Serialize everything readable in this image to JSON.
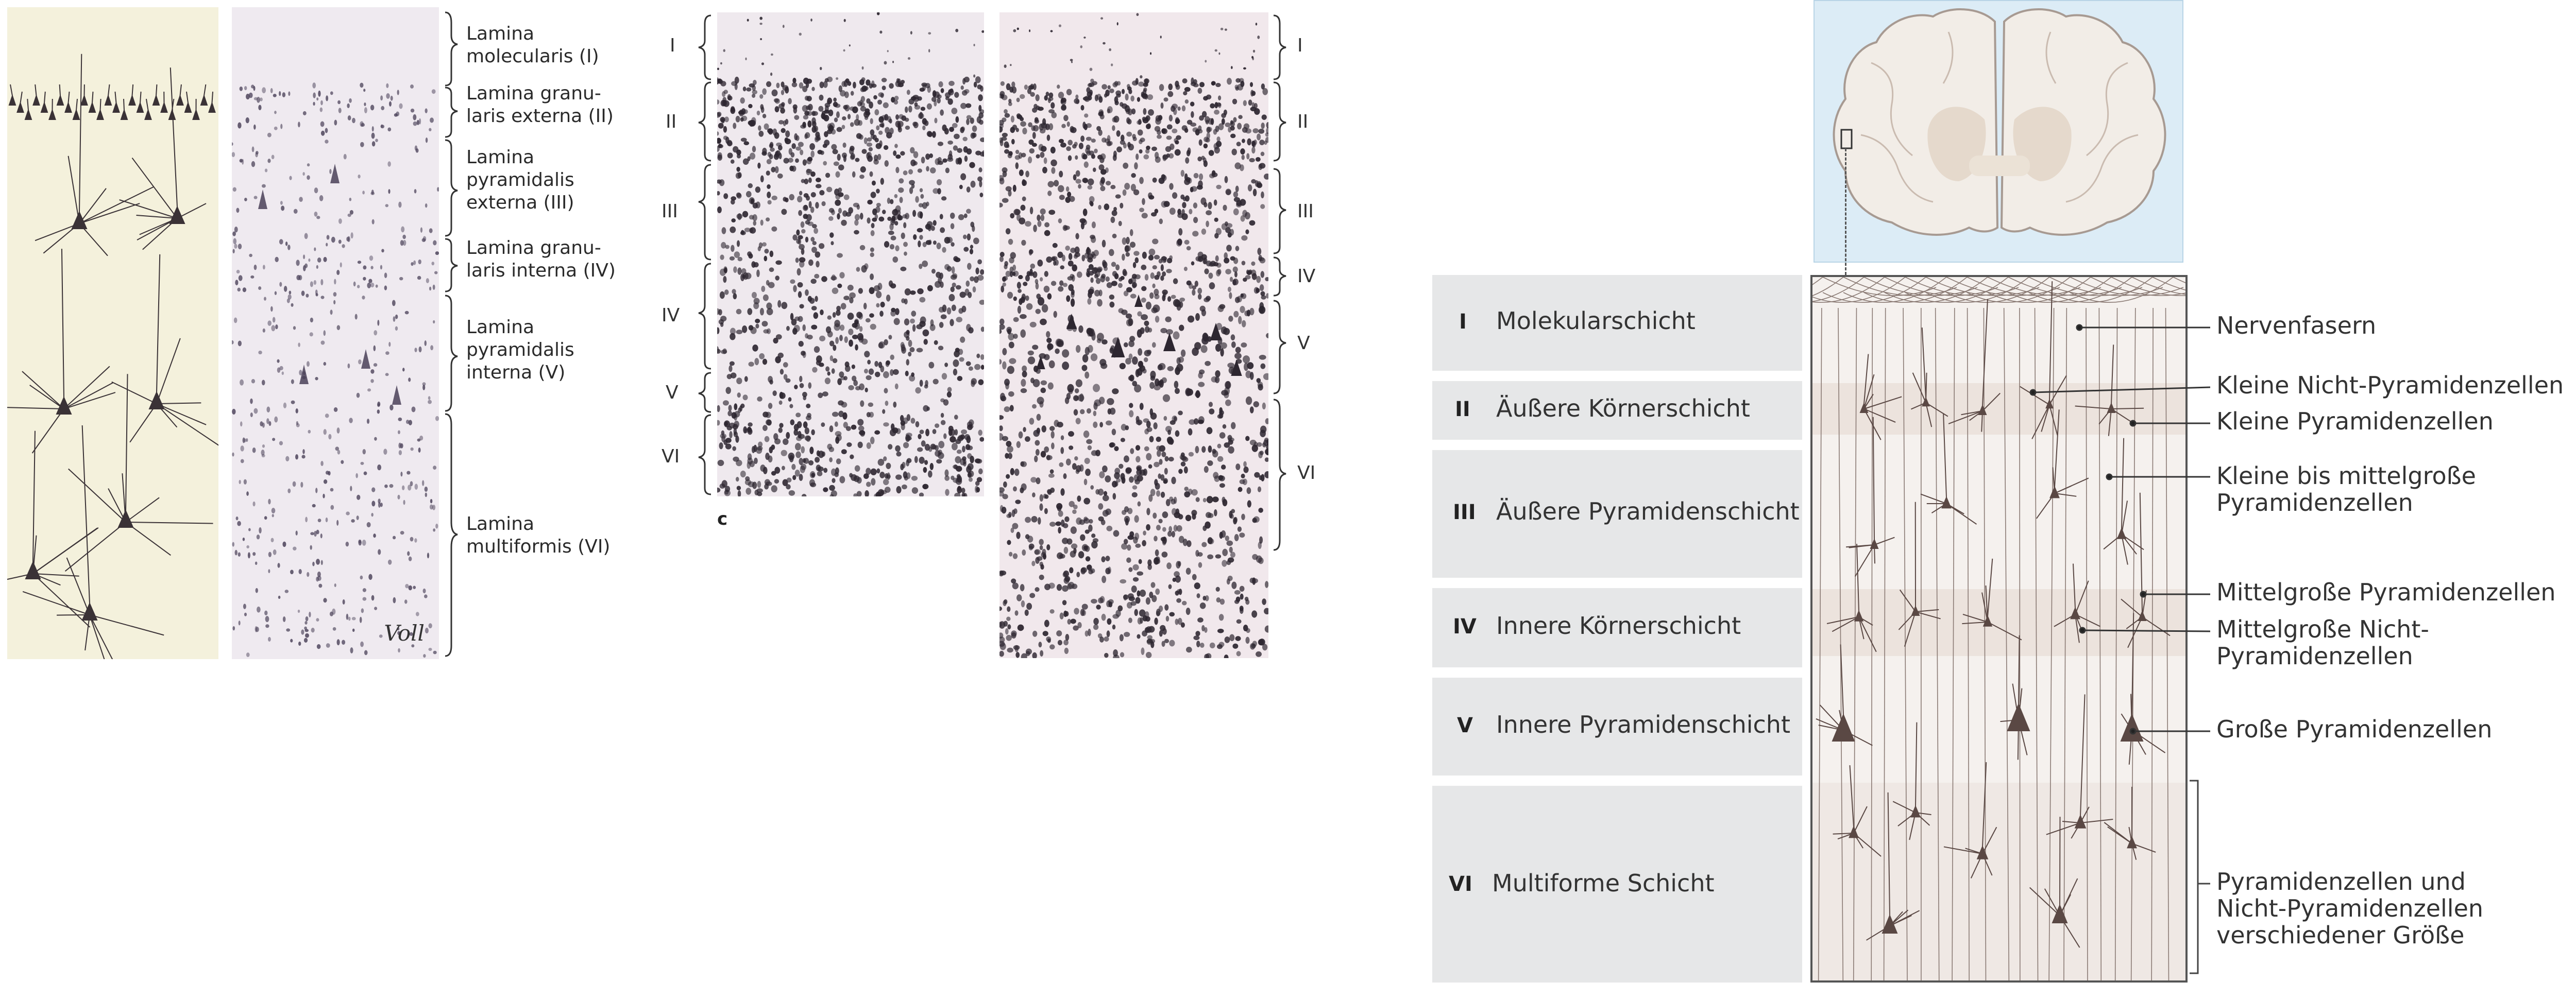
{
  "panel_a": {
    "labels": [
      "Lamina\nmolecularis (I)",
      "Lamina granu-\nlaris externa (II)",
      "Lamina\npyramidalis\nexterna (III)",
      "Lamina granu-\nlaris interna (IV)",
      "Lamina\npyramidalis\ninterna (V)",
      "Lamina\nmultiformis (VI)"
    ],
    "signature": "Voll"
  },
  "panel_c": {
    "left_numerals": [
      "I",
      "II",
      "III",
      "IV",
      "V",
      "VI"
    ],
    "right_numerals": [
      "I",
      "II",
      "III",
      "IV",
      "V",
      "VI"
    ],
    "caption": "c"
  },
  "panel_schema": {
    "layers": [
      {
        "num": "I",
        "name": "Molekularschicht"
      },
      {
        "num": "II",
        "name": "Äußere Körnerschicht"
      },
      {
        "num": "III",
        "name": "Äußere Pyramidenschicht"
      },
      {
        "num": "IV",
        "name": "Innere Körnerschicht"
      },
      {
        "num": "V",
        "name": "Innere Pyramidenschicht"
      },
      {
        "num": "VI",
        "name": "Multiforme Schicht"
      }
    ],
    "annotations": [
      "Nervenfasern",
      "Kleine Nicht-Pyramidenzellen",
      "Kleine Pyramidenzellen",
      "Kleine bis mittelgroße\nPyramidenzellen",
      "Mittelgroße Pyramidenzellen",
      "Mittelgroße Nicht-Pyramidenzellen",
      "Große Pyramidenzellen",
      "Pyramidenzellen und\nNicht-Pyramidenzellen\nverschiedener Größe"
    ]
  },
  "colors": {
    "golgi_bg": "#f4f1dc",
    "nissl_bg": "#efeaf0",
    "stain": "#2d2630",
    "schema_bg": "#f5f1ee",
    "neuron": "#5a4844",
    "brain_bg": "#dcecf6"
  }
}
